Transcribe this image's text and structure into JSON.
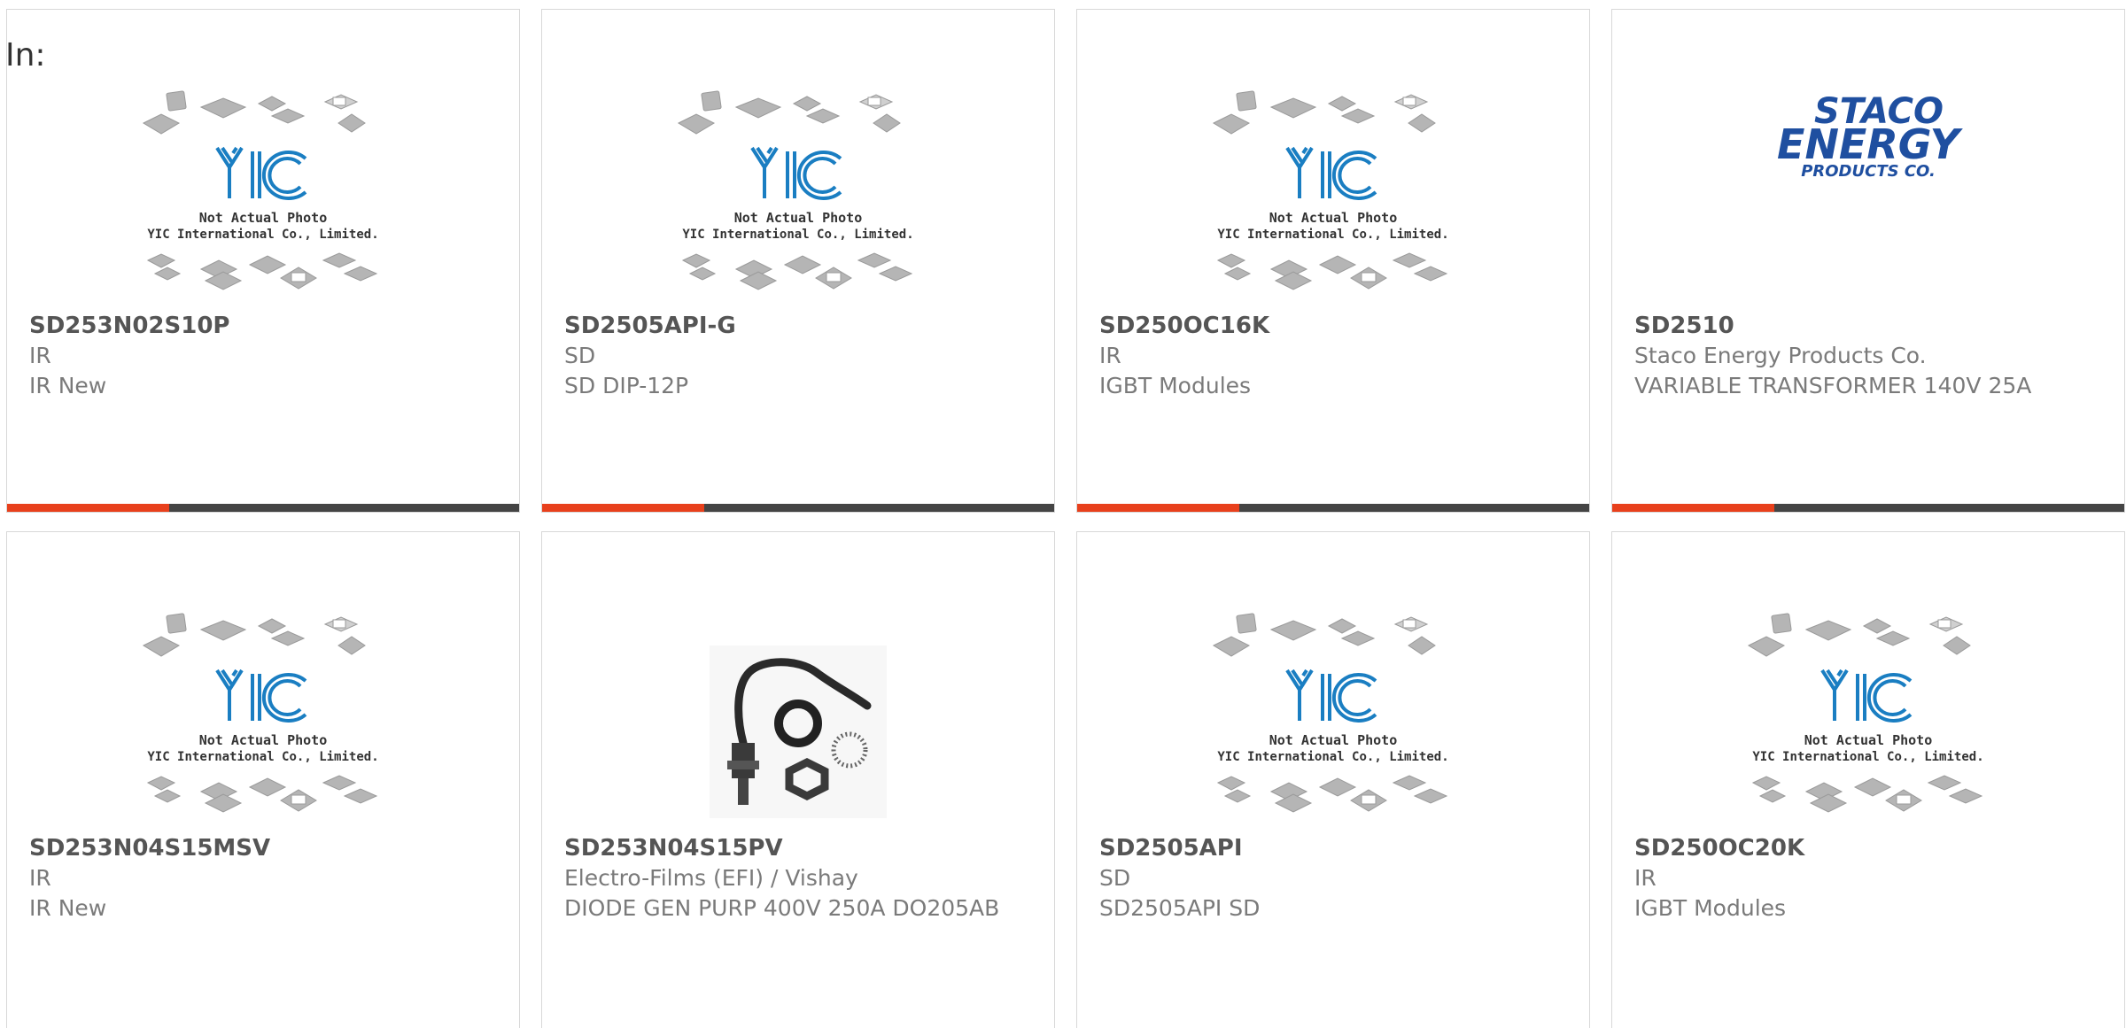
{
  "page": {
    "in_label": "In:"
  },
  "colors": {
    "accent_bar": "#e8401c",
    "dark_bar": "#444444",
    "yic_blue": "#1a7ec2",
    "staco_blue": "#1f4fa0"
  },
  "yic_placeholder": {
    "logo_text": "YIC",
    "caption_line1": "Not Actual Photo",
    "caption_line2": "YIC International Co., Limited."
  },
  "staco_logo": {
    "line1": "STACO",
    "line2": "ENERGY",
    "line3": "PRODUCTS CO."
  },
  "products": [
    {
      "part_number": "SD253N02S10P",
      "manufacturer": "IR",
      "description": "IR New",
      "image_type": "yic-placeholder",
      "has_bar": true
    },
    {
      "part_number": "SD2505API-G",
      "manufacturer": "SD",
      "description": "SD DIP-12P",
      "image_type": "yic-placeholder",
      "has_bar": true
    },
    {
      "part_number": "SD250OC16K",
      "manufacturer": "IR",
      "description": "IGBT Modules",
      "image_type": "yic-placeholder",
      "has_bar": true
    },
    {
      "part_number": "SD2510",
      "manufacturer": "Staco Energy Products Co.",
      "description": "VARIABLE TRANSFORMER 140V 25A",
      "image_type": "staco-logo",
      "has_bar": true
    },
    {
      "part_number": "SD253N04S15MSV",
      "manufacturer": "IR",
      "description": "IR New",
      "image_type": "yic-placeholder",
      "has_bar": false
    },
    {
      "part_number": "SD253N04S15PV",
      "manufacturer": "Electro-Films (EFI) / Vishay",
      "description": "DIODE GEN PURP 400V 250A DO205AB",
      "image_type": "diode-photo",
      "has_bar": false
    },
    {
      "part_number": "SD2505API",
      "manufacturer": "SD",
      "description": "SD2505API SD",
      "image_type": "yic-placeholder",
      "has_bar": false
    },
    {
      "part_number": "SD250OC20K",
      "manufacturer": "IR",
      "description": "IGBT Modules",
      "image_type": "yic-placeholder",
      "has_bar": false
    }
  ]
}
